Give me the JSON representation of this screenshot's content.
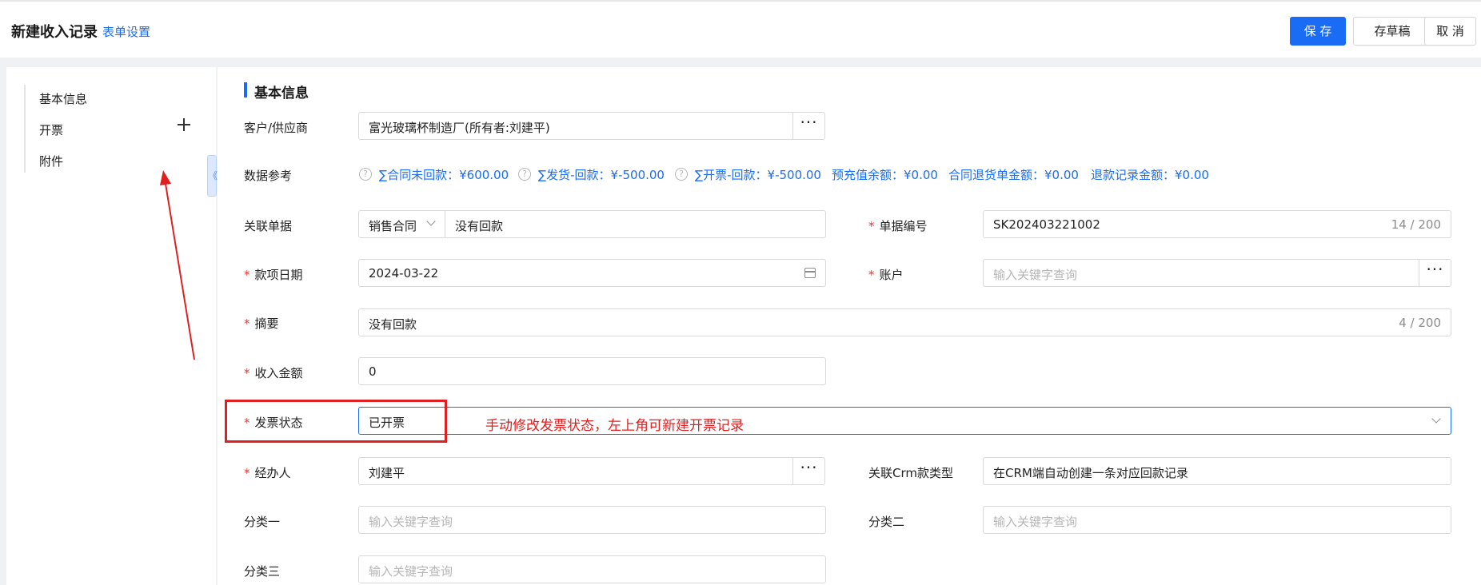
{
  "header": {
    "title": "新建收入记录",
    "form_settings": "表单设置",
    "save_label": "保 存",
    "draft_label": "存草稿",
    "cancel_label": "取 消"
  },
  "sidebar": {
    "items": [
      {
        "label": "基本信息"
      },
      {
        "label": "开票"
      },
      {
        "label": "附件"
      }
    ],
    "collapse_glyph": "《"
  },
  "section": {
    "title": "基本信息"
  },
  "fields": {
    "customer": {
      "label": "客户/供应商",
      "value": "富光玻璃杯制造厂(所有者:刘建平)"
    },
    "data_ref": {
      "label": "数据参考",
      "items": [
        "∑合同未回款：¥600.00",
        "∑发货-回款：¥-500.00",
        "∑开票-回款：¥-500.00",
        "预充值余额：¥0.00",
        "合同退货单金额：¥0.00",
        "退款记录金额：¥0.00"
      ]
    },
    "related_doc": {
      "label": "关联单据",
      "type": "销售合同",
      "value": "没有回款"
    },
    "doc_no": {
      "label": "单据编号",
      "value": "SK202403221002",
      "count": "14 / 200"
    },
    "date": {
      "label": "款项日期",
      "value": "2024-03-22"
    },
    "account": {
      "label": "账户",
      "placeholder": "输入关键字查询"
    },
    "summary": {
      "label": "摘要",
      "value": "没有回款",
      "count": "4 / 200"
    },
    "amount": {
      "label": "收入金额",
      "value": "0"
    },
    "invoice_status": {
      "label": "发票状态",
      "value": "已开票"
    },
    "handler": {
      "label": "经办人",
      "value": "刘建平"
    },
    "crm_type": {
      "label": "关联Crm款类型",
      "value": "在CRM端自动创建一条对应回款记录"
    },
    "category1": {
      "label": "分类一",
      "placeholder": "输入关键字查询"
    },
    "category2": {
      "label": "分类二",
      "placeholder": "输入关键字查询"
    },
    "category3": {
      "label": "分类三",
      "placeholder": "输入关键字查询"
    }
  },
  "annotation": {
    "text": "手动修改发票状态，左上角可新建开票记录",
    "color": "#e02020"
  },
  "colors": {
    "primary": "#1a6cf5",
    "required": "#e53935"
  },
  "required_mark": "*",
  "dots": "···"
}
